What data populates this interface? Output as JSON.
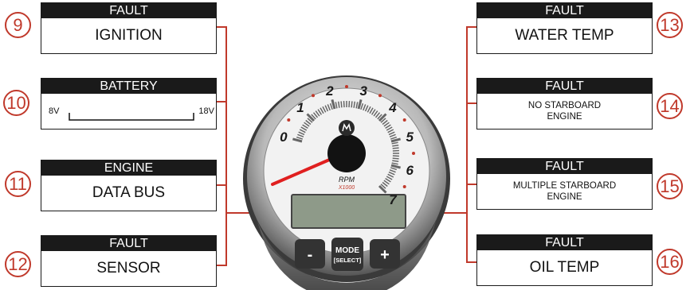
{
  "callouts": [
    {
      "num": "9",
      "header": "FAULT",
      "body": "IGNITION"
    },
    {
      "num": "10",
      "header": "BATTERY",
      "body": "",
      "min": "8V",
      "max": "18V"
    },
    {
      "num": "11",
      "header": "ENGINE",
      "body": "DATA BUS"
    },
    {
      "num": "12",
      "header": "FAULT",
      "body": "SENSOR"
    },
    {
      "num": "13",
      "header": "FAULT",
      "body": "WATER TEMP"
    },
    {
      "num": "14",
      "header": "FAULT",
      "body": "NO STARBOARD ENGINE"
    },
    {
      "num": "15",
      "header": "FAULT",
      "body": "MULTIPLE STARBOARD ENGINE"
    },
    {
      "num": "16",
      "header": "FAULT",
      "body": "OIL TEMP"
    }
  ],
  "gauge": {
    "dial_numbers": [
      "0",
      "1",
      "2",
      "3",
      "4",
      "5",
      "6",
      "7"
    ],
    "unit": "RPM",
    "multiplier": "X1000",
    "buttons": {
      "minus": "-",
      "mode": "MODE",
      "select": "[SELECT]",
      "plus": "+"
    }
  },
  "colors": {
    "accent": "#c0392b",
    "header": "#1a1a1a",
    "lcd": "#8e9a89"
  }
}
